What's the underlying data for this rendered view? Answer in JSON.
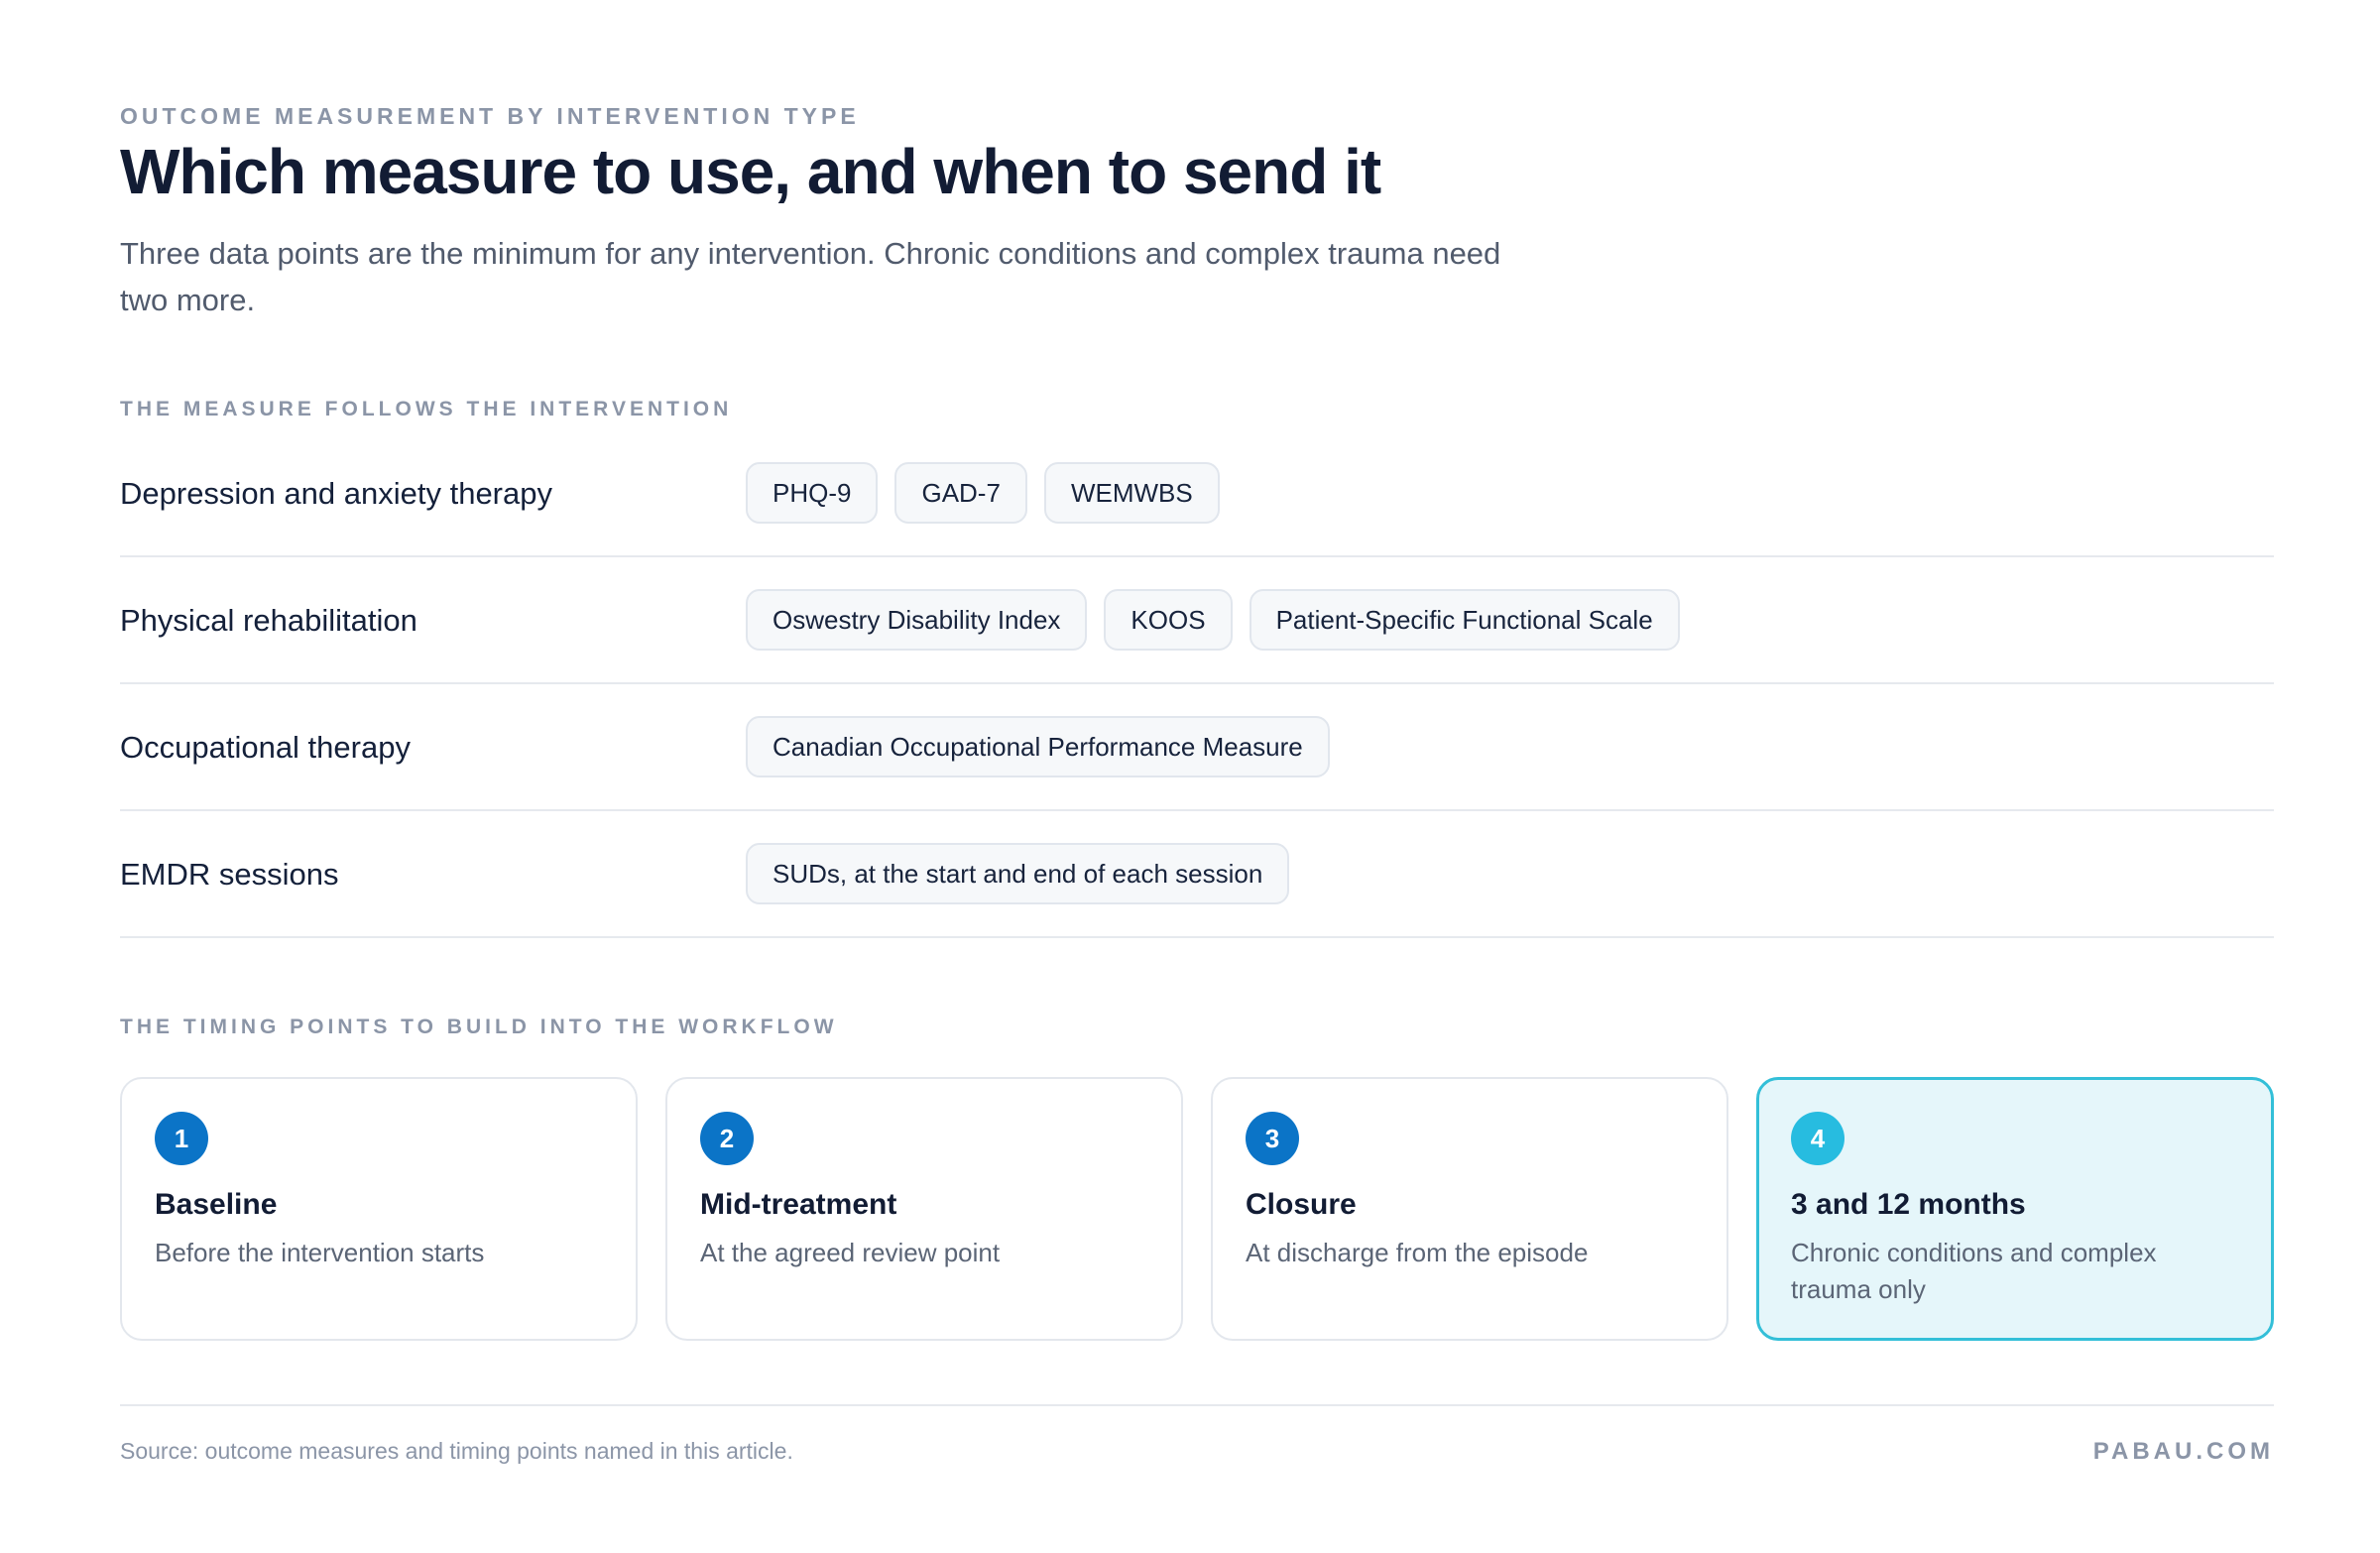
{
  "header": {
    "eyebrow": "OUTCOME MEASUREMENT BY INTERVENTION TYPE",
    "title": "Which measure to use, and when to send it",
    "subtitle": "Three data points are the minimum for any intervention. Chronic conditions and complex trauma need two more."
  },
  "measures": {
    "section_label": "THE MEASURE FOLLOWS THE INTERVENTION",
    "rows": [
      {
        "intervention": "Depression and anxiety therapy",
        "measures": [
          "PHQ-9",
          "GAD-7",
          "WEMWBS"
        ]
      },
      {
        "intervention": "Physical rehabilitation",
        "measures": [
          "Oswestry Disability Index",
          "KOOS",
          "Patient-Specific Functional Scale"
        ]
      },
      {
        "intervention": "Occupational therapy",
        "measures": [
          "Canadian Occupational Performance Measure"
        ]
      },
      {
        "intervention": "EMDR sessions",
        "measures": [
          "SUDs, at the start and end of each session"
        ]
      }
    ]
  },
  "timing": {
    "section_label": "THE TIMING POINTS TO BUILD INTO THE WORKFLOW",
    "cards": [
      {
        "number": "1",
        "title": "Baseline",
        "description": "Before the intervention starts"
      },
      {
        "number": "2",
        "title": "Mid-treatment",
        "description": "At the agreed review point"
      },
      {
        "number": "3",
        "title": "Closure",
        "description": "At discharge from the episode"
      },
      {
        "number": "4",
        "title": "3 and 12 months",
        "description": "Chronic conditions and complex trauma only"
      }
    ]
  },
  "footer": {
    "source": "Source: outcome measures and timing points named in this article.",
    "brand": "PABAU.COM"
  },
  "colors": {
    "badge_blue": "#0b74c7",
    "highlight_border": "#33bfd8",
    "highlight_fill": "#e5f6fa",
    "highlight_badge": "#27bce0"
  }
}
